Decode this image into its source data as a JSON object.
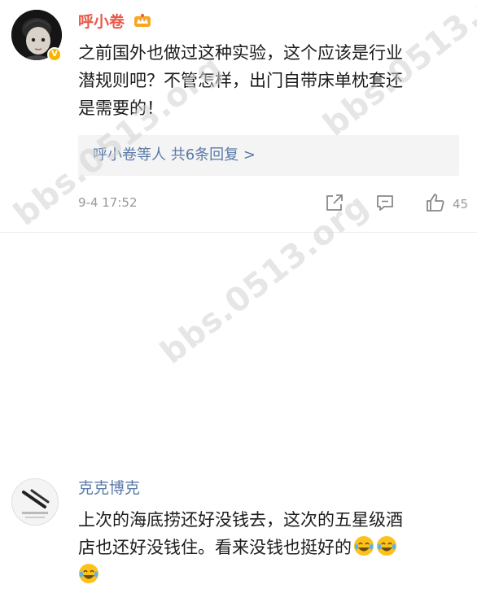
{
  "comments": [
    {
      "username": "呼小卷",
      "content_lines": [
        "之前国外也做过这种实验，这个应该是行业",
        "潜规则吧？不管怎样，出门自带床单枕套还",
        "是需要的！"
      ],
      "replies_link": "呼小卷等人  共6条回复 >",
      "timestamp": "9-4 17:52",
      "like_count": "45",
      "icons": [
        "share-icon",
        "comment-icon",
        "like-icon",
        "vip-crown-icon",
        "verified-badge-icon"
      ]
    },
    {
      "username": "克克博克",
      "content_lines": [
        "上次的海底捞还好没钱去，这次的五星级酒",
        "店也还好没钱住。看来没钱也挺好的"
      ],
      "emoji": "laughing-tears-emoji"
    }
  ],
  "watermark": "bbs.0513.org"
}
